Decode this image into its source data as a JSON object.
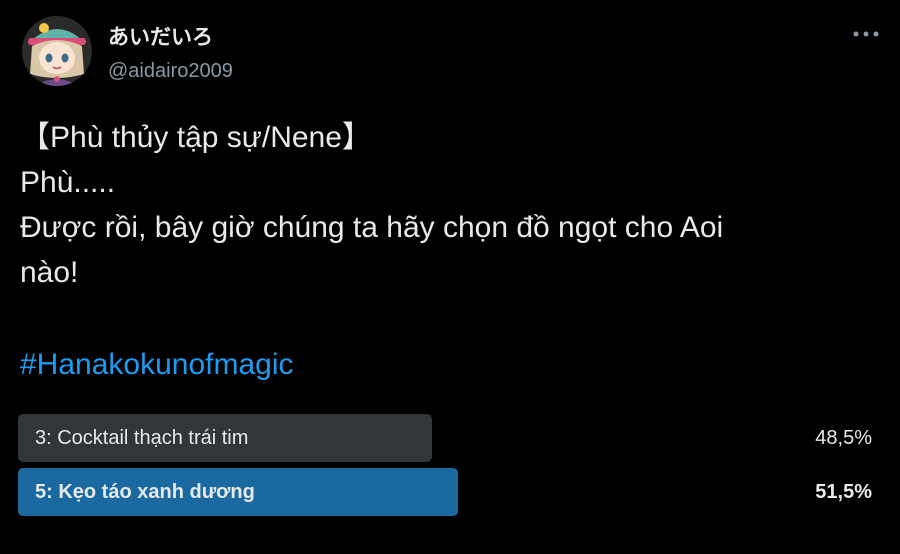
{
  "author": {
    "display_name": "あいだいろ",
    "handle": "@aidairo2009",
    "avatar_icon": "anime-character-avatar"
  },
  "more_icon": "more-dots-icon",
  "tweet": {
    "lines": [
      "【Phù thủy tập sự/Nene】",
      "Phù.....",
      "Được rồi, bây giờ chúng ta hãy chọn đồ ngọt cho Aoi",
      "nào!"
    ],
    "hashtag": "#Hanakokunofmagic"
  },
  "poll": {
    "options": [
      {
        "label": "3: Cocktail thạch trái tim",
        "percent_text": "48,5%",
        "percent": 48.5,
        "winner": false
      },
      {
        "label": "5: Kẹo táo xanh dương",
        "percent_text": "51,5%",
        "percent": 51.5,
        "winner": true
      }
    ]
  },
  "colors": {
    "background": "#000000",
    "text": "#e7e9ea",
    "muted": "#8b98a5",
    "link": "#1d9bf0",
    "poll_bar": "#333639",
    "poll_winner_bar": "#1a6aa1"
  }
}
